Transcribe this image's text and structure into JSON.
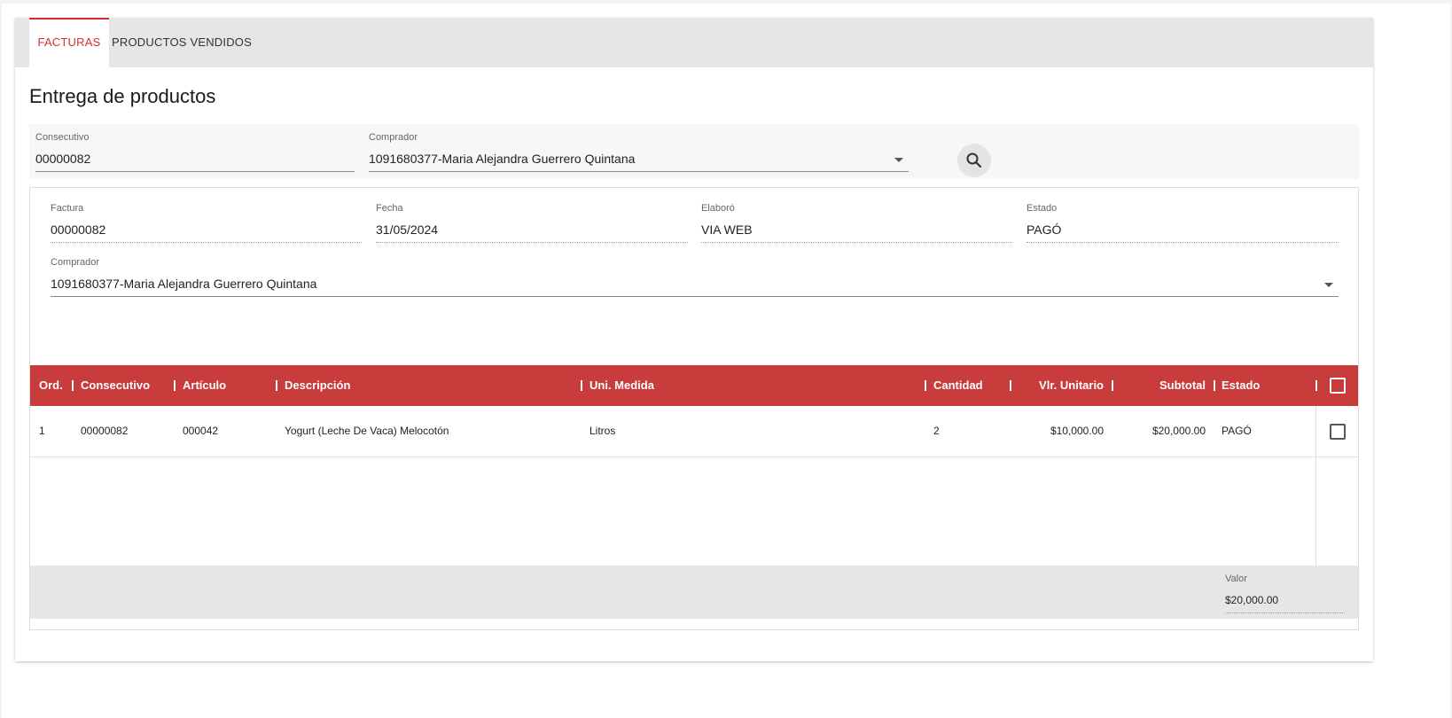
{
  "tabs": [
    {
      "label": "FACTURAS",
      "active": true
    },
    {
      "label": "PRODUCTOS VENDIDOS",
      "active": false
    }
  ],
  "page_title": "Entrega de productos",
  "search": {
    "consecutivo_label": "Consecutivo",
    "consecutivo_value": "00000082",
    "comprador_label": "Comprador",
    "comprador_value": "1091680377-Maria Alejandra Guerrero Quintana",
    "search_icon": "search-icon"
  },
  "invoice": {
    "factura_label": "Factura",
    "factura_value": "00000082",
    "fecha_label": "Fecha",
    "fecha_value": "31/05/2024",
    "elaboro_label": "Elaboró",
    "elaboro_value": "VIA WEB",
    "estado_label": "Estado",
    "estado_value": "PAGÓ",
    "comprador_label": "Comprador",
    "comprador_value": "1091680377-Maria Alejandra Guerrero Quintana"
  },
  "grid": {
    "columns": [
      "Ord.",
      "Consecutivo",
      "Artículo",
      "Descripción",
      "Uni. Medida",
      "Cantidad",
      "Vlr. Unitario",
      "Subtotal",
      "Estado"
    ],
    "rows": [
      {
        "ord": "1",
        "consecutivo": "00000082",
        "articulo": "000042",
        "descripcion": "Yogurt (Leche De Vaca) Melocotón",
        "uni_medida": "Litros",
        "cantidad": "2",
        "vlr_unitario": "$10,000.00",
        "subtotal": "$20,000.00",
        "estado": "PAGÓ",
        "checked": false
      }
    ],
    "footer": {
      "valor_label": "Valor",
      "valor_value": "$20,000.00"
    }
  },
  "colors": {
    "accent": "#d32f2f",
    "grid_header": "#c83c3c"
  }
}
